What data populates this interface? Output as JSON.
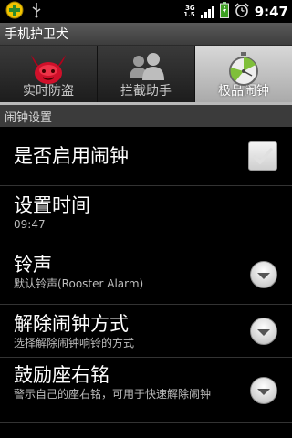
{
  "status_bar": {
    "time": "9:47",
    "network": "3G",
    "network_sub": "1.5",
    "icons": [
      "app-notification-icon",
      "usb-icon",
      "signal-icon",
      "battery-icon",
      "alarm-icon"
    ]
  },
  "title_bar": {
    "title": "手机护卫犬"
  },
  "tabs": [
    {
      "label": "实时防盗",
      "icon": "devil-icon",
      "active": false
    },
    {
      "label": "拦截助手",
      "icon": "users-icon",
      "active": false
    },
    {
      "label": "极品闹钟",
      "icon": "stopwatch-icon",
      "active": true
    }
  ],
  "section_header": {
    "label": "闹钟设置"
  },
  "settings": [
    {
      "title": "是否启用闹钟",
      "subtitle": "",
      "control": "checkbox",
      "checked": true
    },
    {
      "title": "设置时间",
      "subtitle": "09:47",
      "control": "none"
    },
    {
      "title": "铃声",
      "subtitle": "默认铃声(Rooster Alarm)",
      "control": "dropdown"
    },
    {
      "title": "解除闹钟方式",
      "subtitle": "选择解除闹钟响铃的方式",
      "control": "dropdown"
    },
    {
      "title": "鼓励座右铭",
      "subtitle": "警示自己的座右铭，可用于快速解除闹钟",
      "control": "dropdown"
    }
  ],
  "colors": {
    "background": "#000000",
    "active_tab": "#bdbdbd",
    "section_header": "#3b3b3b"
  }
}
